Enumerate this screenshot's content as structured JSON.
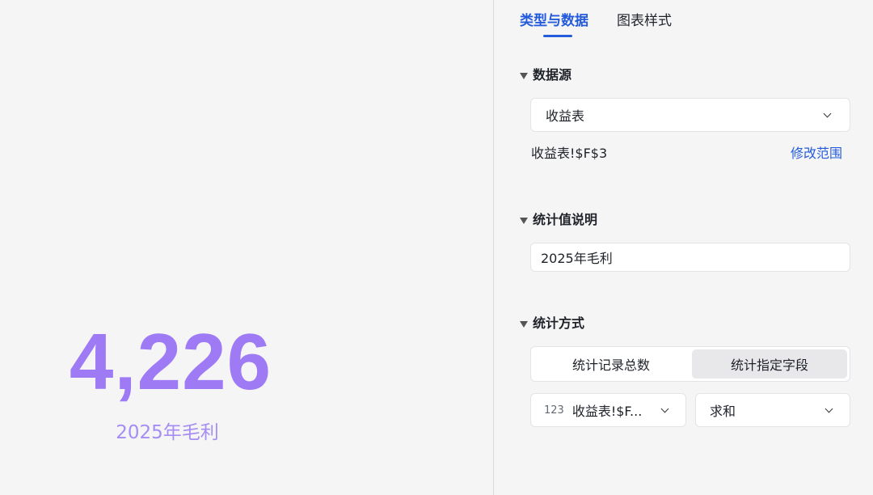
{
  "preview": {
    "value": "4,226",
    "caption": "2025年毛利",
    "value_color": "#9e7bf5"
  },
  "tabs": [
    {
      "label": "类型与数据",
      "active": true
    },
    {
      "label": "图表样式",
      "active": false
    }
  ],
  "data_source": {
    "title": "数据源",
    "selected_sheet": "收益表",
    "range": "收益表!$F$3",
    "modify_range_label": "修改范围"
  },
  "stat_description": {
    "title": "统计值说明",
    "value": "2025年毛利"
  },
  "stat_method": {
    "title": "统计方式",
    "options": [
      "统计记录总数",
      "统计指定字段"
    ],
    "selected_option": "统计指定字段",
    "field_type_icon": "123",
    "field_value": "收益表!$F...",
    "aggregate_value": "求和"
  },
  "colors": {
    "accent": "#245bdb",
    "background": "#f5f5f6"
  }
}
